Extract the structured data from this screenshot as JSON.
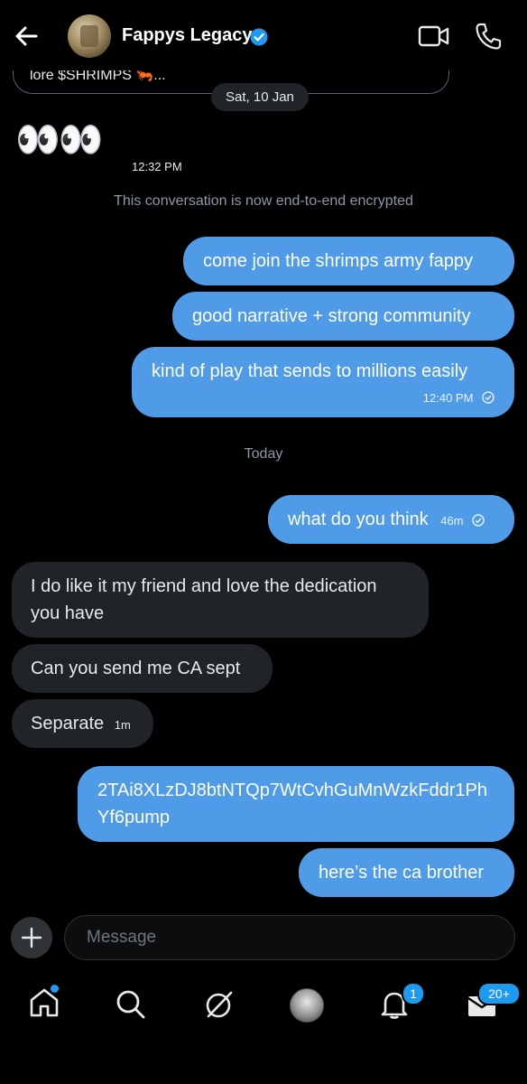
{
  "header": {
    "contact_name": "Fappys Legacy",
    "back_icon": "arrow-left-icon",
    "verified_icon": "verified-badge-icon",
    "video_icon": "video-call-icon",
    "phone_icon": "phone-icon"
  },
  "quote_preview": {
    "text": "lore $SHRIMPS 🦐..."
  },
  "date_separators": {
    "first": "Sat, 10 Jan",
    "second": "Today"
  },
  "encryption_notice": "This conversation is now end-to-end encrypted",
  "messages": [
    {
      "direction": "received",
      "text": "👀👀",
      "time": "12:32 PM"
    },
    {
      "direction": "sent",
      "text": "come join the shrimps army fappy"
    },
    {
      "direction": "sent",
      "text": "good narrative + strong community"
    },
    {
      "direction": "sent",
      "text": "kind of play that sends to millions easily",
      "time": "12:40 PM",
      "status": "sent-check-icon"
    },
    {
      "direction": "sent",
      "text": "what do you think",
      "time": "46m",
      "status": "sent-check-icon"
    },
    {
      "direction": "received",
      "text": "I do like it my friend and love the dedication you have"
    },
    {
      "direction": "received",
      "text": "Can you send me CA sept"
    },
    {
      "direction": "received",
      "text": "Separate",
      "time": "1m"
    },
    {
      "direction": "sent",
      "text": "2TAi8XLzDJ8btNTQp7WtCvhGuMnWzkFddr1PhYf6pump"
    },
    {
      "direction": "sent",
      "text": "here’s the ca brother"
    }
  ],
  "composer": {
    "placeholder": "Message",
    "add_icon": "plus-icon"
  },
  "nav": {
    "items": [
      "home-icon",
      "search-icon",
      "grok-icon",
      "profile-avatar",
      "notifications-icon",
      "messages-icon"
    ],
    "notifications_badge": "1",
    "messages_badge": "20+"
  },
  "colors": {
    "sent_bubble": "#4f9be8",
    "received_bubble": "#202327",
    "accent": "#1d9bf0",
    "background": "#000000"
  }
}
